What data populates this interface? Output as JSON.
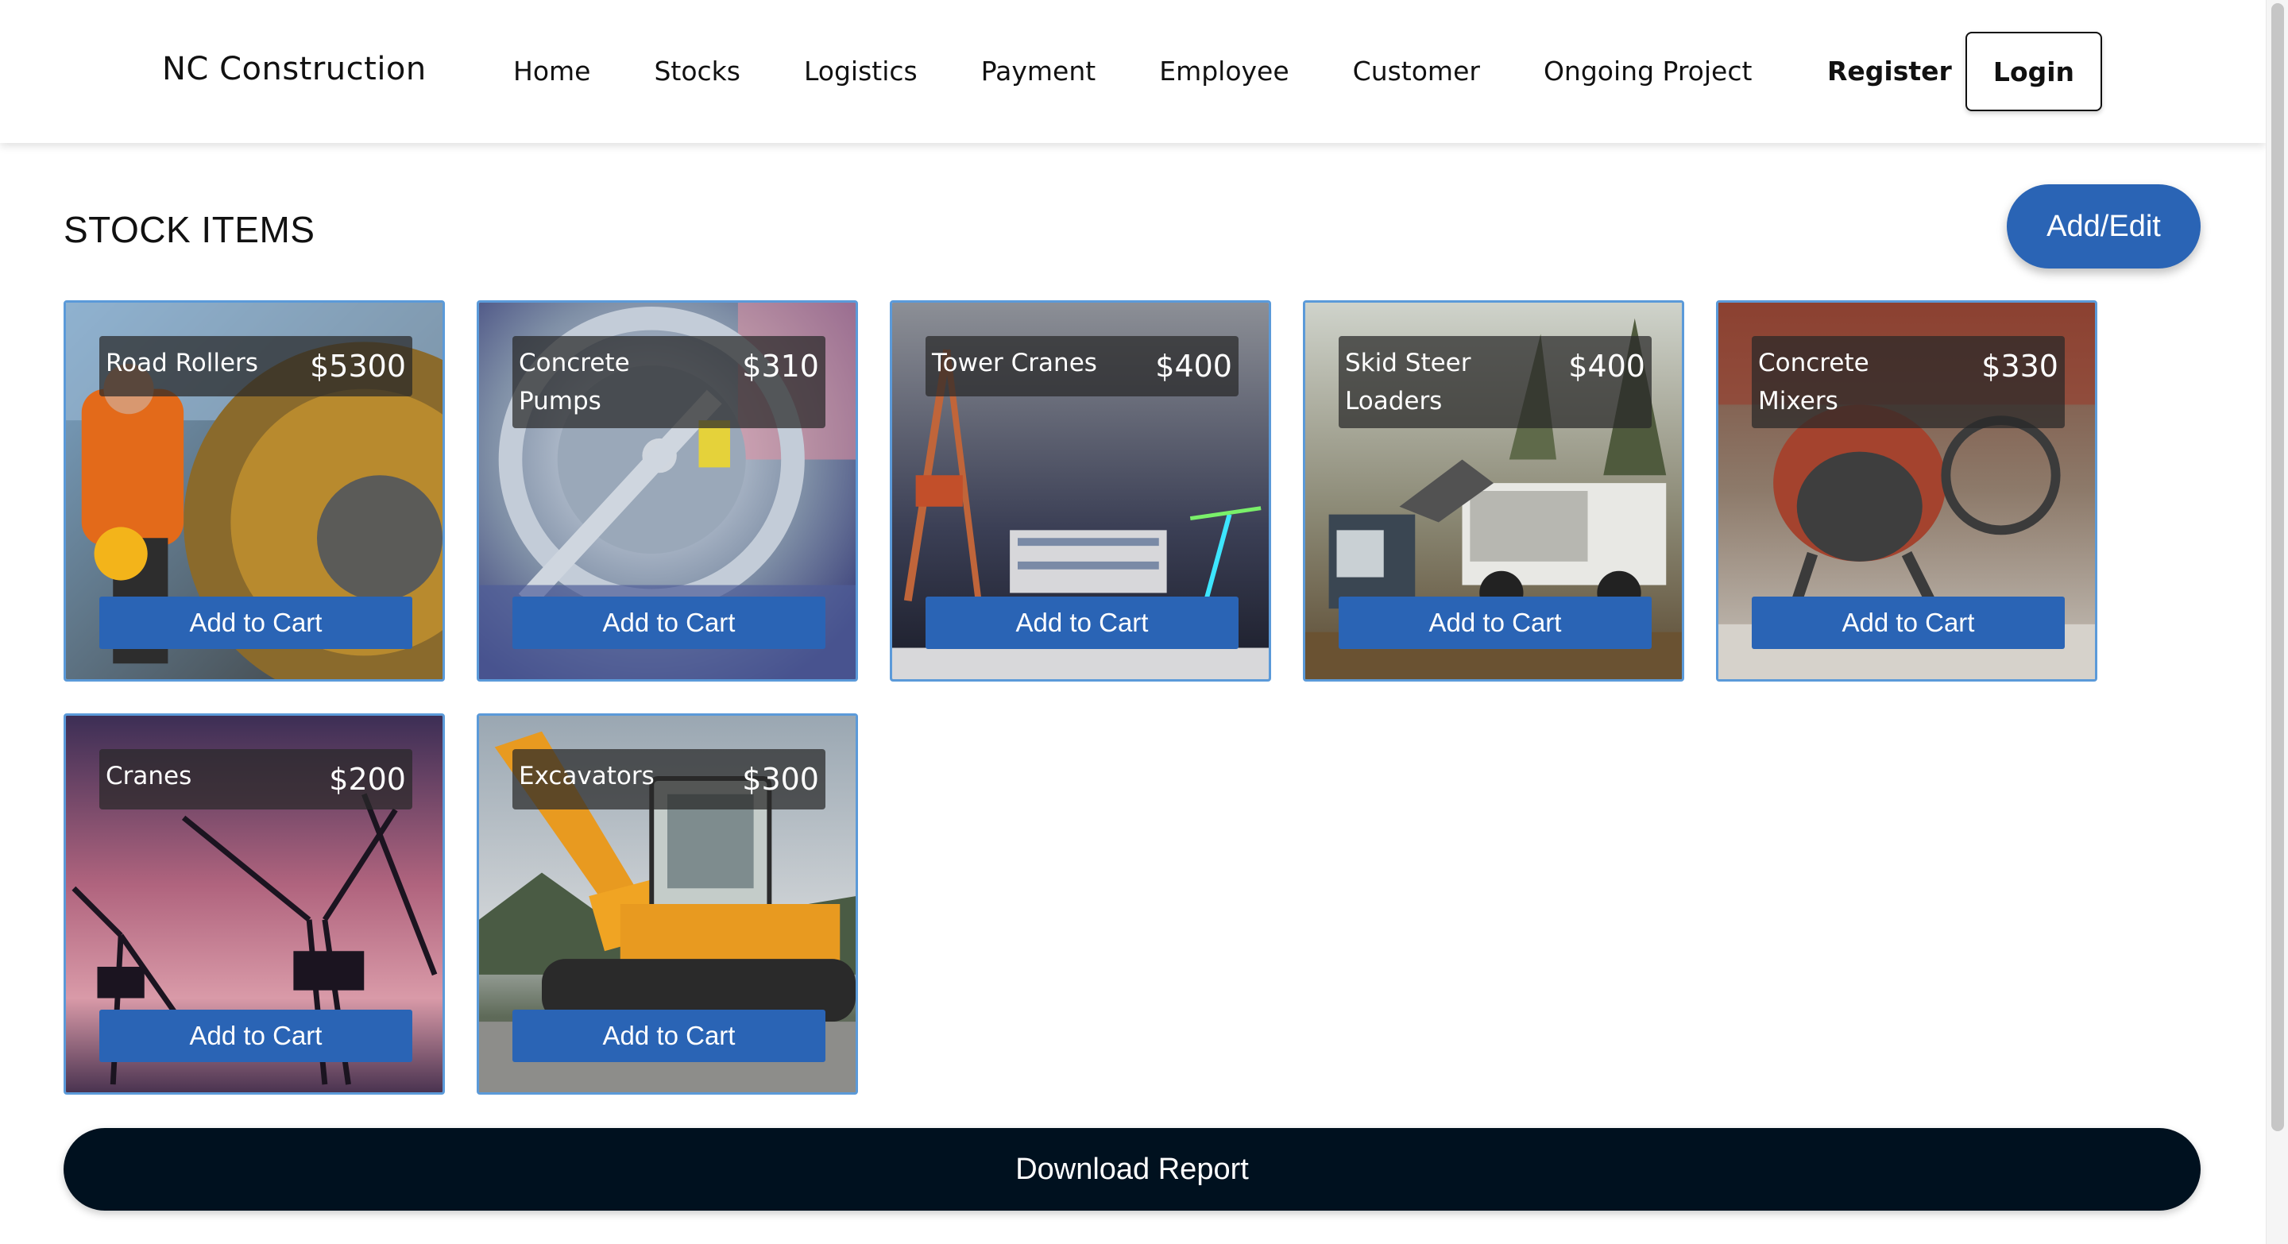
{
  "header": {
    "brand": "NC Construction",
    "nav": [
      "Home",
      "Stocks",
      "Logistics",
      "Payment",
      "Employee",
      "Customer",
      "Ongoing Project"
    ],
    "register_label": "Register",
    "login_label": "Login"
  },
  "stock": {
    "title": "STOCK ITEMS",
    "add_edit_label": "Add/Edit",
    "cart_label": "Add to Cart",
    "items": [
      {
        "name": "Road Rollers",
        "price": "$5300"
      },
      {
        "name": "Concrete Pumps",
        "price": "$310"
      },
      {
        "name": "Tower Cranes",
        "price": "$400"
      },
      {
        "name": "Skid Steer Loaders",
        "price": "$400"
      },
      {
        "name": "Concrete Mixers",
        "price": "$330"
      },
      {
        "name": "Cranes",
        "price": "$200"
      },
      {
        "name": "Excavators",
        "price": "$300"
      }
    ]
  },
  "download_label": "Download Report",
  "colors": {
    "accent": "#2a64b5",
    "download": "#00111f",
    "card_border": "#5b9ad9"
  }
}
